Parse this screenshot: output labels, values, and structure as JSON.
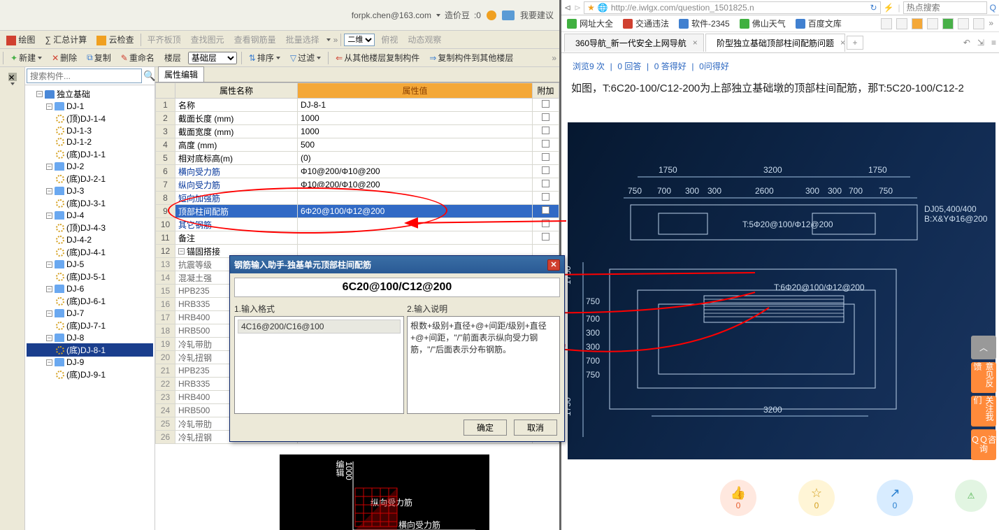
{
  "top_info": {
    "email": "forpk.chen@163.com",
    "bean_prefix": "造价豆",
    "bean_count": ":0",
    "suggest": "我要建议"
  },
  "toolbar1": {
    "draw": "绘图",
    "sum": "∑ 汇总计算",
    "cloud": "云检查",
    "flat": "平齐板顶",
    "viewfig": "查找图元",
    "viewsteel": "查看钢筋量",
    "batch": "批量选择",
    "dim_sel": "二维",
    "top": "俯视",
    "dyn": "动态观察"
  },
  "toolbar2": {
    "new": "新建",
    "del": "删除",
    "copy": "复制",
    "rename": "重命名",
    "floor": "楼层",
    "base_layer": "基础层",
    "sort": "排序",
    "filter": "过滤",
    "copy_from": "从其他楼层复制构件",
    "copy_to": "复制构件到其他楼层"
  },
  "tree": {
    "search_placeholder": "搜索构件...",
    "root": "独立基础",
    "nodes": [
      {
        "id": "DJ-1",
        "children": [
          "(顶)DJ-1-4",
          "DJ-1-3",
          "DJ-1-2",
          "(底)DJ-1-1"
        ]
      },
      {
        "id": "DJ-2",
        "children": [
          "(底)DJ-2-1"
        ]
      },
      {
        "id": "DJ-3",
        "children": [
          "(底)DJ-3-1"
        ]
      },
      {
        "id": "DJ-4",
        "children": [
          "(顶)DJ-4-3",
          "DJ-4-2",
          "(底)DJ-4-1"
        ]
      },
      {
        "id": "DJ-5",
        "children": [
          "(底)DJ-5-1"
        ]
      },
      {
        "id": "DJ-6",
        "children": [
          "(底)DJ-6-1"
        ]
      },
      {
        "id": "DJ-7",
        "children": [
          "(底)DJ-7-1"
        ]
      },
      {
        "id": "DJ-8",
        "children": [
          "(底)DJ-8-1"
        ]
      },
      {
        "id": "DJ-9",
        "children": [
          "(底)DJ-9-1"
        ]
      }
    ],
    "selected": "(底)DJ-8-1"
  },
  "props": {
    "tab": "属性编辑",
    "cols": {
      "name": "属性名称",
      "value": "属性值",
      "extra": "附加"
    },
    "rows": [
      {
        "n": "1",
        "name": "名称",
        "value": "DJ-8-1"
      },
      {
        "n": "2",
        "name": "截面长度 (mm)",
        "value": "1000"
      },
      {
        "n": "3",
        "name": "截面宽度 (mm)",
        "value": "1000"
      },
      {
        "n": "4",
        "name": "高度 (mm)",
        "value": "500"
      },
      {
        "n": "5",
        "name": "相对底标高(m)",
        "value": "(0)"
      },
      {
        "n": "6",
        "name": "横向受力筋",
        "value": "Φ10@200/Φ10@200",
        "blue": true
      },
      {
        "n": "7",
        "name": "纵向受力筋",
        "value": "Φ10@200/Φ10@200",
        "blue": true
      },
      {
        "n": "8",
        "name": "短向加强筋",
        "value": "",
        "blue": true
      },
      {
        "n": "9",
        "name": "顶部柱间配筋",
        "value": "6Φ20@100/Φ12@200",
        "blue": true,
        "sel": true
      },
      {
        "n": "10",
        "name": "其它钢筋",
        "value": "",
        "blue": true
      },
      {
        "n": "11",
        "name": "备注",
        "value": ""
      },
      {
        "n": "12",
        "name": "锚固搭接",
        "expand": true
      },
      {
        "n": "13",
        "name": "抗震等级",
        "dim": true
      },
      {
        "n": "14",
        "name": "混凝土强",
        "dim": true
      },
      {
        "n": "15",
        "name": "HPB235",
        "dim": true
      },
      {
        "n": "16",
        "name": "HRB335",
        "dim": true
      },
      {
        "n": "17",
        "name": "HRB400",
        "dim": true
      },
      {
        "n": "18",
        "name": "HRB500",
        "dim": true
      },
      {
        "n": "19",
        "name": "冷轧带肋",
        "dim": true
      },
      {
        "n": "20",
        "name": "冷轧扭钢",
        "dim": true
      },
      {
        "n": "21",
        "name": "HPB235",
        "dim": true
      },
      {
        "n": "22",
        "name": "HRB335",
        "dim": true
      },
      {
        "n": "23",
        "name": "HRB400",
        "dim": true
      },
      {
        "n": "24",
        "name": "HRB500",
        "dim": true
      },
      {
        "n": "25",
        "name": "冷轧带肋",
        "dim": true
      },
      {
        "n": "26",
        "name": "冷轧扭钢",
        "dim": true
      }
    ]
  },
  "dialog": {
    "title": "钢筋输入助手-独基单元顶部柱间配筋",
    "heading": "6C20@100/C12@200",
    "col1_label": "1.输入格式",
    "col2_label": "2.输入说明",
    "format_item": "4C16@200/C16@100",
    "explain": "根数+级别+直径+@+间距/级别+直径+@+间距，\"/\"前面表示纵向受力钢筋，\"/\"后面表示分布钢筋。",
    "ok": "确定",
    "cancel": "取消"
  },
  "canvas": {
    "vlabel": "编辑",
    "yval": "1000",
    "lab1": "纵向受力筋",
    "lab2": "横向受力筋"
  },
  "browser": {
    "url": "http://e.iwlgx.com/question_1501825.n",
    "url_search_placeholder": "热点搜索",
    "bookmarks": [
      {
        "label": "网址大全",
        "color": "#40b040"
      },
      {
        "label": "交通违法",
        "color": "#d04030"
      },
      {
        "label": "软件-2345",
        "color": "#4080d0"
      },
      {
        "label": "佛山天气",
        "color": "#40b040"
      },
      {
        "label": "百度文库",
        "color": "#4080d0"
      }
    ],
    "tabs": [
      {
        "label": "360导航_新一代安全上网导航",
        "active": false
      },
      {
        "label": "阶型独立基础顶部柱间配筋问题",
        "active": true
      }
    ],
    "meta": {
      "views": "浏览9 次",
      "sep": "|",
      "ans": "0 回答",
      "good_ans": "0 答得好",
      "good_q": "0问得好"
    },
    "desc": "如图，T:6C20-100/C12-200为上部独立基础墩的顶部柱间配筋，那T:5C20-100/C12-2",
    "side_tabs": {
      "top": "︿",
      "feedback": "意见反馈",
      "follow": "关注我们",
      "qq": "ＱＱ咨询"
    },
    "actions": {
      "like": "0",
      "fav": "0",
      "share": "0"
    }
  },
  "blueprint": {
    "top_dims": [
      "1750",
      "3200",
      "1750"
    ],
    "row2_dims": [
      "750",
      "700",
      "300",
      "300",
      "2600",
      "300",
      "300",
      "700",
      "750"
    ],
    "notes": [
      "T:5Φ20@100/Φ12@200",
      "T:6Φ20@100/Φ12@200"
    ],
    "side_note_a": "DJ05,400/400",
    "side_note_b": "B:X&YΦ16@200",
    "bottom_dim": "3200",
    "left_dims": [
      "1750",
      "750",
      "700",
      "300",
      "300",
      "700",
      "750",
      "1750"
    ]
  }
}
